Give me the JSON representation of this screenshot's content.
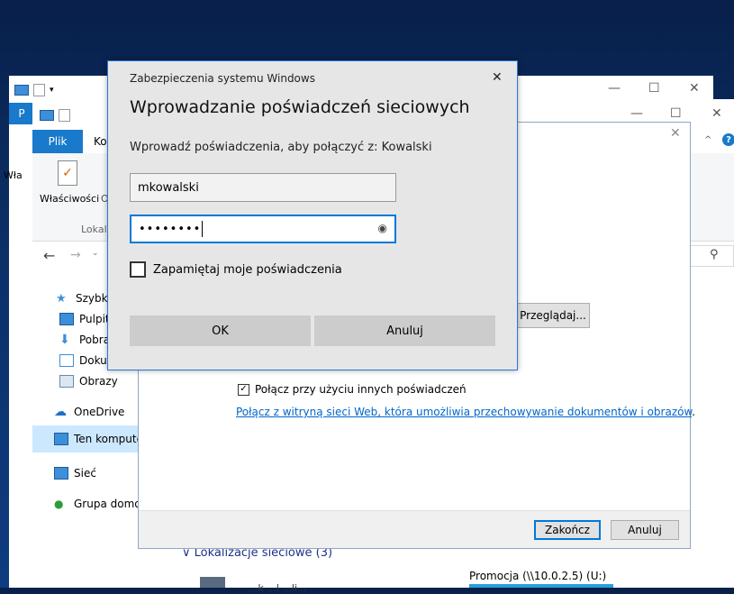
{
  "explorer_back": {
    "tab_file": "P",
    "controls": {
      "min": "—",
      "max": "☐",
      "close": "✕"
    }
  },
  "explorer_front": {
    "tab_file": "Plik",
    "tab_computer": "Ko",
    "ribbon_left": "Wła",
    "ribbon_properties": "Właściwości",
    "ribbon_open_partial": "O",
    "ribbon_group": "Lokal",
    "controls": {
      "min": "—",
      "max": "☐",
      "close": "✕"
    },
    "nav": {
      "quick_access": "Szybki d",
      "desktop": "Pulpit",
      "downloads": "Pobra",
      "documents": "Dokumenty",
      "pictures": "Obrazy",
      "onedrive": "OneDrive",
      "this_pc": "Ten komputer",
      "network": "Sieć",
      "homegroup": "Grupa domowa"
    },
    "network_locations_header": "Lokalizacje sieciowe (3)",
    "drive_label": "Promocja (\\\\10.0.2.5) (U:)",
    "drive_partial": "...k ...l ...li..."
  },
  "map_drive": {
    "close": "✕",
    "browse_button": "Przeglądaj...",
    "other_credentials_label": "Połącz przy użyciu innych poświadczeń",
    "other_credentials_checked": true,
    "website_link": "Połącz z witryną sieci Web, która umożliwia przechowywanie dokumentów i obrazów",
    "website_link_end": ".",
    "finish_button": "Zakończ",
    "cancel_button": "Anuluj"
  },
  "credential_dialog": {
    "caption": "Zabezpieczenia systemu Windows",
    "close": "✕",
    "title": "Wprowadzanie poświadczeń sieciowych",
    "prompt": "Wprowadź poświadczenia, aby połączyć z: Kowalski",
    "username_value": "mkowalski",
    "password_value": "••••••••",
    "reveal_icon": "eye-icon",
    "remember_label": "Zapamiętaj moje poświadczenia",
    "remember_checked": false,
    "ok_button": "OK",
    "cancel_button": "Anuluj"
  },
  "search_icon": "search-icon",
  "help_icon": "?"
}
